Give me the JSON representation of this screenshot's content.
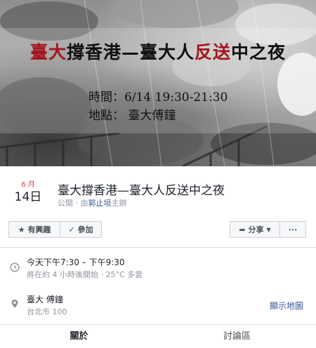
{
  "cover": {
    "title_red1": "臺大",
    "title_mid": "撐香港—臺大人",
    "title_red2": "反送",
    "title_end": "中之夜",
    "time_line": "時間：6/14 19:30-21:30",
    "place_line": "地點： 臺大傅鐘"
  },
  "event": {
    "month": "6 月",
    "day": "14日",
    "title": "臺大撐香港—臺大人反送中之夜",
    "privacy": "公開",
    "host_prefix": " · 由",
    "host": "郭止垣",
    "host_suffix": "主辦"
  },
  "actions": {
    "interested": "有興趣",
    "going": "參加",
    "share": "分享",
    "more": "···"
  },
  "time": {
    "line1": "今天下午7:30 – 下午9:30",
    "line2": "將在約 4 小時後開始 · 25°C 多雲"
  },
  "location": {
    "line1": "臺大 傅鐘",
    "line2": "台北市 100",
    "map_link": "顯示地圖"
  },
  "tabs": [
    {
      "label": "關於"
    },
    {
      "label": "討論區"
    }
  ],
  "colors": {
    "accent_red": "#a4161c",
    "month_red": "#e13c30",
    "link_blue": "#385898"
  }
}
